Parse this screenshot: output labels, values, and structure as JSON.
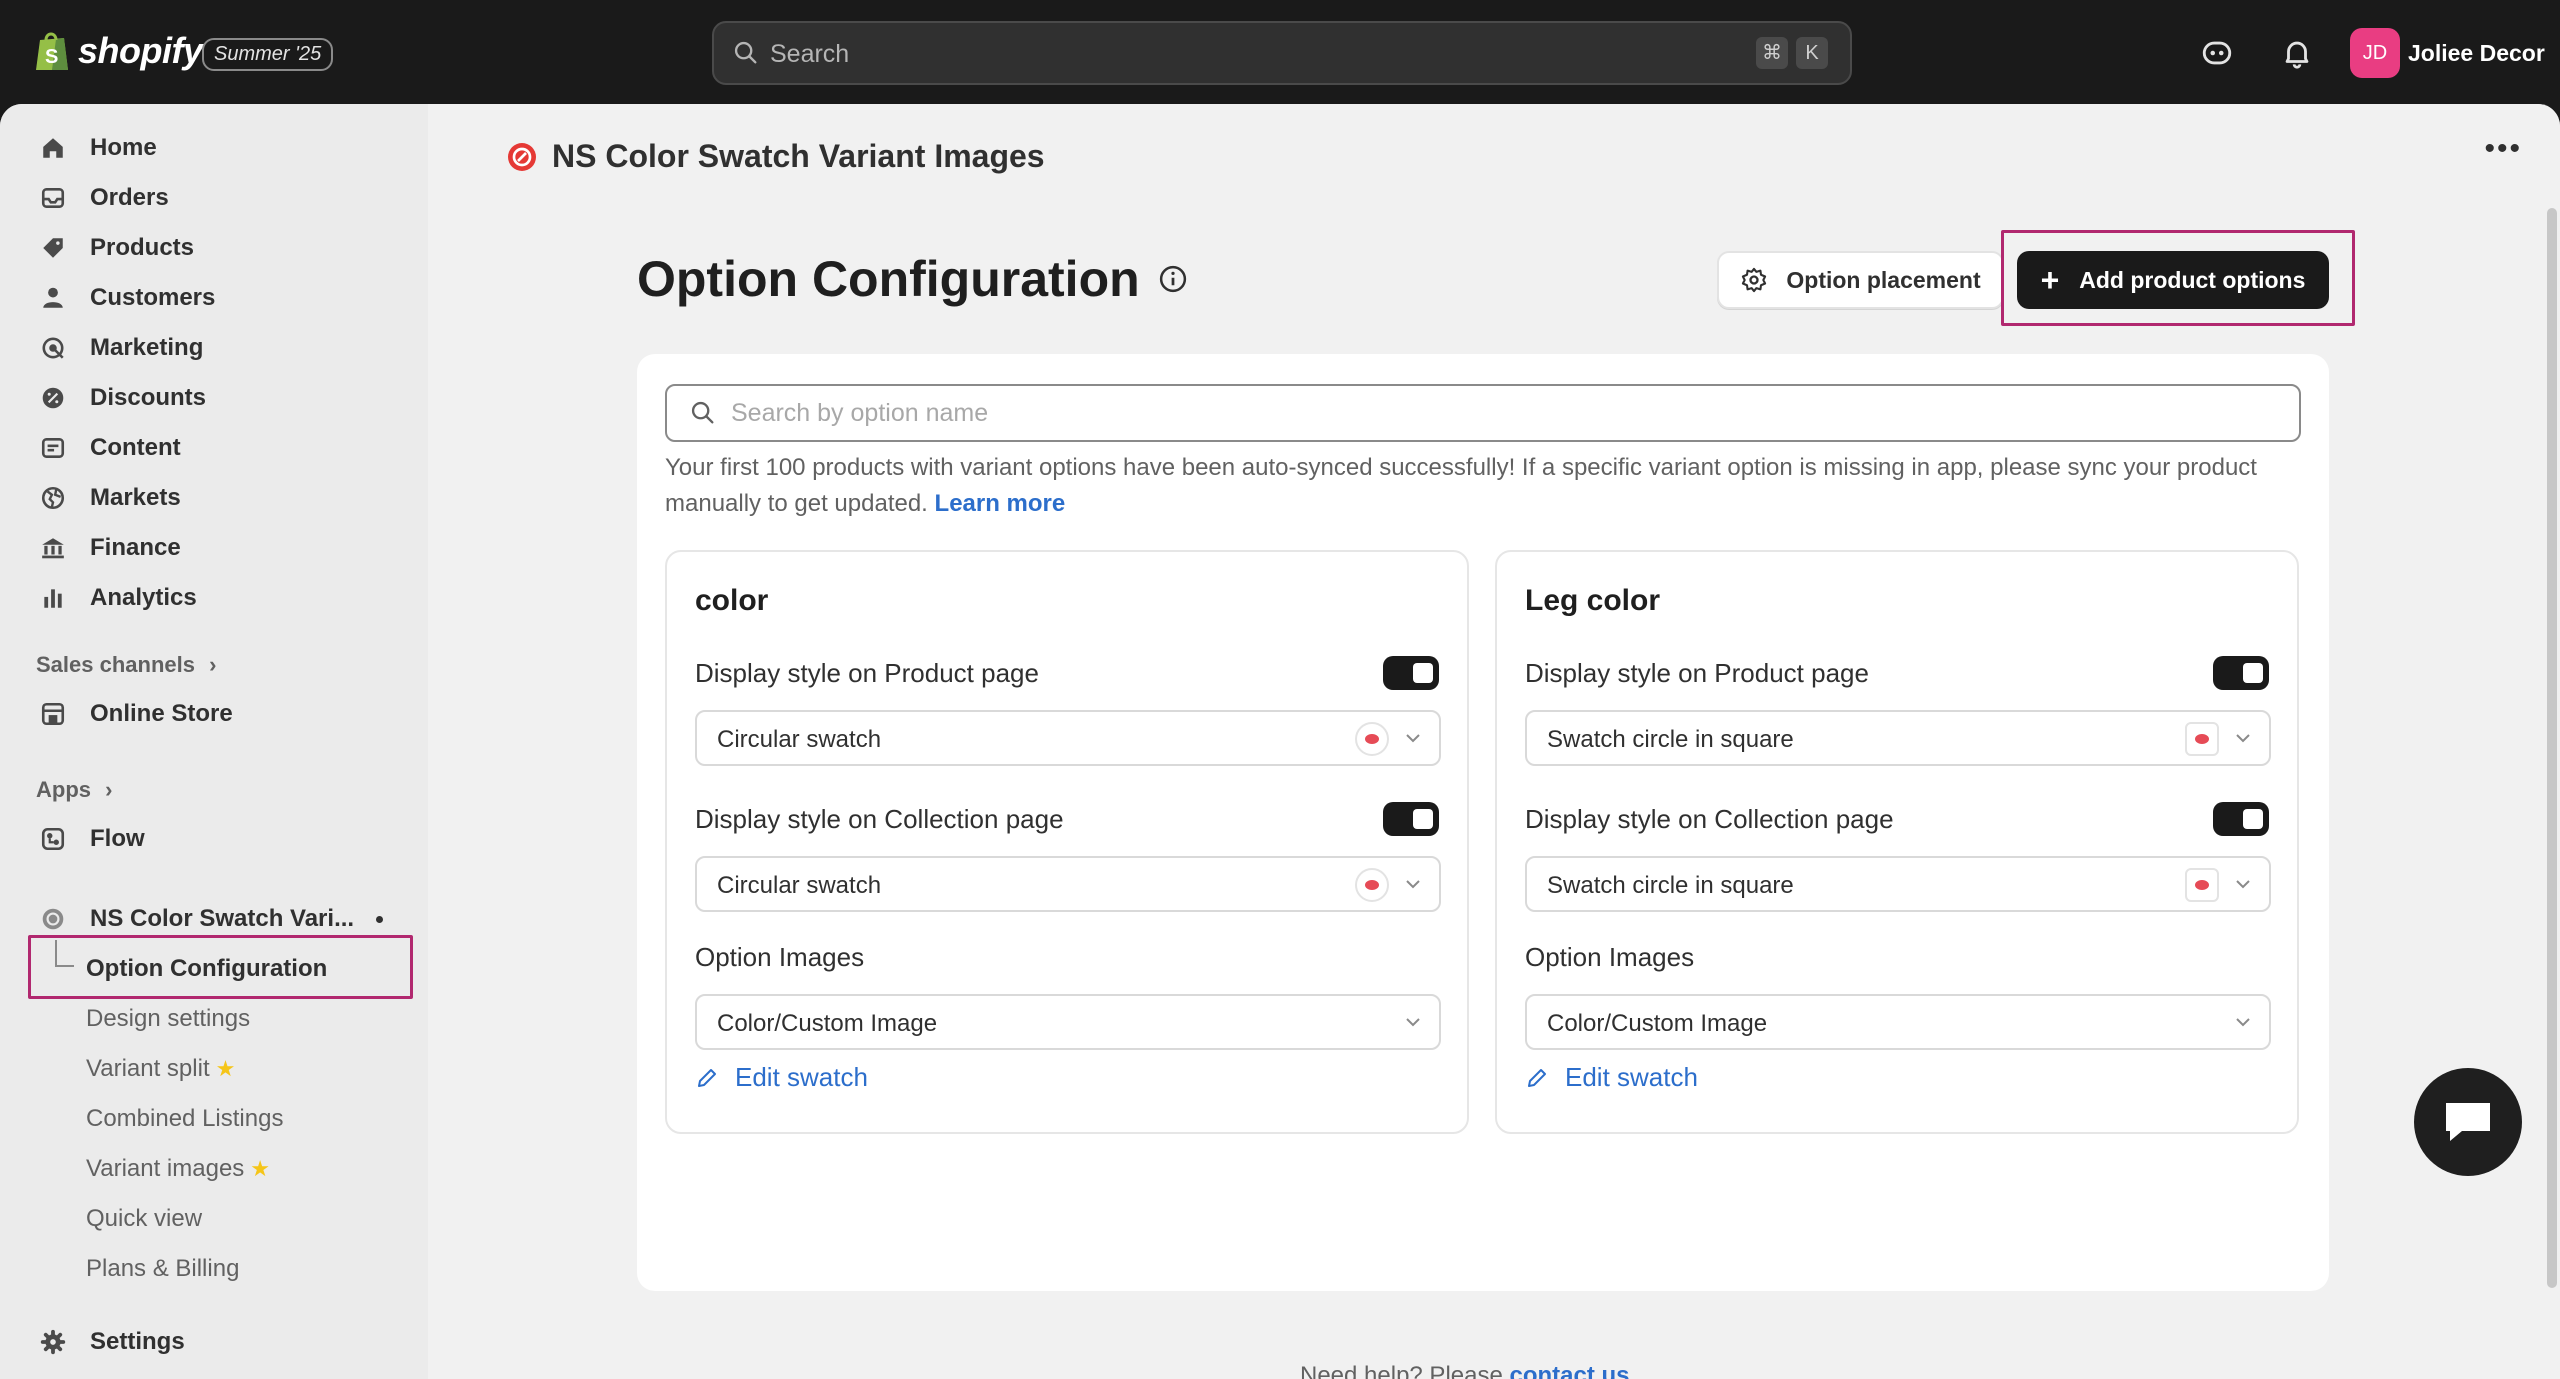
{
  "topbar": {
    "brand": "shopify",
    "edition": "Summer '25",
    "search_placeholder": "Search",
    "shortcut_keys": [
      "⌘",
      "K"
    ],
    "avatar_initials": "JD",
    "store_name": "Joliee Decor"
  },
  "sidebar": {
    "items": [
      {
        "label": "Home",
        "icon": "home-icon"
      },
      {
        "label": "Orders",
        "icon": "orders-icon"
      },
      {
        "label": "Products",
        "icon": "tag-icon"
      },
      {
        "label": "Customers",
        "icon": "person-icon"
      },
      {
        "label": "Marketing",
        "icon": "target-icon"
      },
      {
        "label": "Discounts",
        "icon": "discount-icon"
      },
      {
        "label": "Content",
        "icon": "content-icon"
      },
      {
        "label": "Markets",
        "icon": "globe-icon"
      },
      {
        "label": "Finance",
        "icon": "bank-icon"
      },
      {
        "label": "Analytics",
        "icon": "bar-chart-icon"
      }
    ],
    "sales_channels_label": "Sales channels",
    "online_store_label": "Online Store",
    "apps_label": "Apps",
    "flow_label": "Flow",
    "app_label": "NS Color Swatch Vari...",
    "app_sub_items": [
      "Option Configuration",
      "Design settings",
      "Variant split",
      "Combined Listings",
      "Variant images",
      "Quick view",
      "Plans & Billing"
    ],
    "settings_label": "Settings"
  },
  "app_header": {
    "title": "NS Color Swatch Variant Images"
  },
  "page": {
    "title": "Option Configuration",
    "option_placement_label": "Option placement",
    "add_options_label": "Add product options",
    "search_placeholder": "Search by option name",
    "notice_text": "Your first 100 products with variant options have been auto-synced successfully! If a specific variant option is missing in app, please sync your product manually to get updated.",
    "learn_more": "Learn more",
    "help_text": "Need help? Please",
    "help_link": "contact us"
  },
  "options": [
    {
      "name": "color",
      "product_label": "Display style on Product page",
      "product_value": "Circular swatch",
      "product_enabled": true,
      "collection_label": "Display style on Collection page",
      "collection_value": "Circular swatch",
      "collection_enabled": true,
      "images_label": "Option Images",
      "images_value": "Color/Custom Image",
      "edit_label": "Edit swatch"
    },
    {
      "name": "Leg color",
      "product_label": "Display style on Product page",
      "product_value": "Swatch circle in square",
      "product_enabled": true,
      "collection_label": "Display style on Collection page",
      "collection_value": "Swatch circle in square",
      "collection_enabled": true,
      "images_label": "Option Images",
      "images_value": "Color/Custom Image",
      "edit_label": "Edit swatch"
    }
  ],
  "colors": {
    "highlight": "#b1286f",
    "link": "#2c6ecb",
    "avatar": "#e93d82",
    "swatch": "#e64b56"
  }
}
